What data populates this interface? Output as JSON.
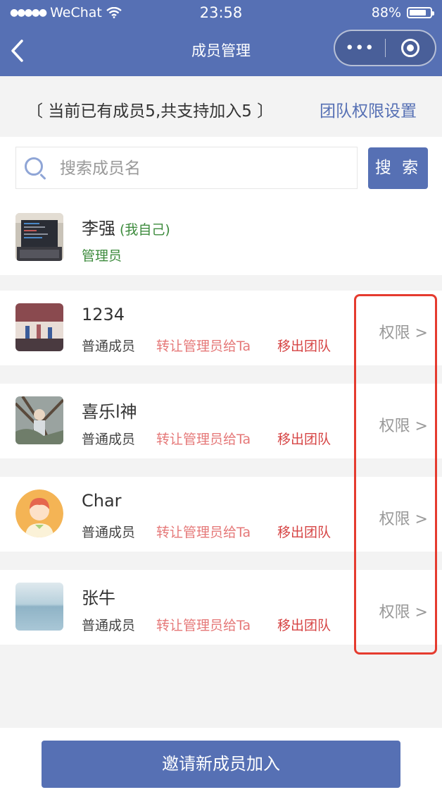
{
  "status_bar": {
    "carrier": "WeChat",
    "time": "23:58",
    "battery": "88%",
    "battery_level": 0.88
  },
  "nav": {
    "title": "成员管理",
    "more_glyph": "•••"
  },
  "info": {
    "count_text": "〔 当前已有成员5,共支持加入5 〕",
    "permission_link": "团队权限设置"
  },
  "search": {
    "placeholder": "搜索成员名",
    "value": "",
    "button_label": "搜 索"
  },
  "members": [
    {
      "name": "李强",
      "self_tag": "(我自己)",
      "role": "管理员",
      "avatar_icon": "laptop-photo"
    },
    {
      "name": "1234",
      "role": "普通成员",
      "transfer": "转让管理员给Ta",
      "remove": "移出团队",
      "perm": "权限 >",
      "avatar_icon": "photo"
    },
    {
      "name": "喜乐l神",
      "role": "普通成员",
      "transfer": "转让管理员给Ta",
      "remove": "移出团队",
      "perm": "权限 >",
      "avatar_icon": "tree-photo"
    },
    {
      "name": "Char",
      "role": "普通成员",
      "transfer": "转让管理员给Ta",
      "remove": "移出团队",
      "perm": "权限 >",
      "avatar_icon": "cartoon-person"
    },
    {
      "name": "张牛",
      "role": "普通成员",
      "transfer": "转让管理员给Ta",
      "remove": "移出团队",
      "perm": "权限 >",
      "avatar_icon": "sea-photo"
    }
  ],
  "invite_button": "邀请新成员加入",
  "colors": {
    "primary": "#5670b4",
    "admin_green": "#3d8b3d",
    "transfer_red": "#e57878",
    "remove_red": "#d64444",
    "highlight_red": "#e53b2f"
  }
}
